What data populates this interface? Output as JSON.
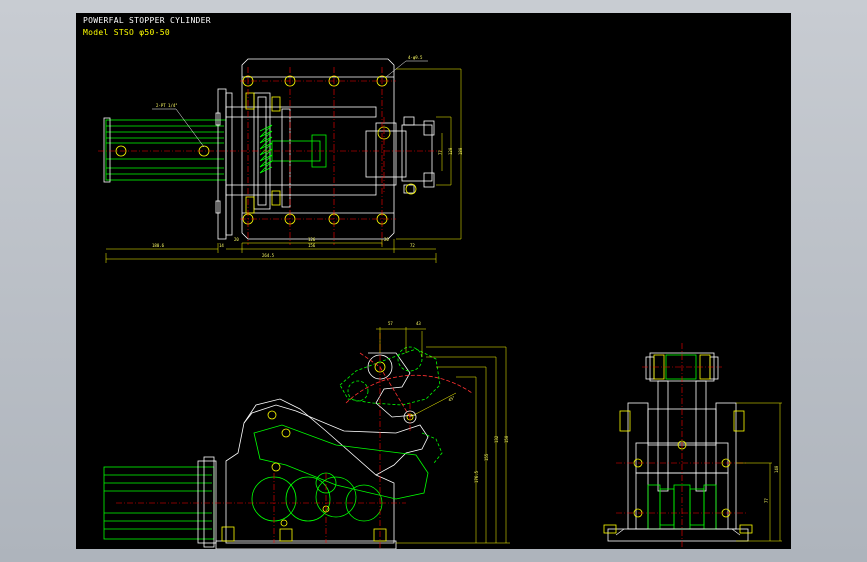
{
  "drawing": {
    "title": "POWERFAL STOPPER CYLINDER",
    "model": "Model STSO φ50-50",
    "colors": {
      "background": "#000000",
      "outline": "#ffffff",
      "centerline": "#ff0000",
      "hidden": "#00ff00",
      "dimension": "#ffff00",
      "arc": "#ff3030"
    }
  },
  "top_view": {
    "callouts": {
      "port": "2-PT 1/4\"",
      "holes": "4-φ9.5"
    },
    "dims": {
      "overall": "264.5",
      "cyl_length": "180.6",
      "flange": "14",
      "d1": "20",
      "span_inner": "126",
      "span_outer": "156",
      "d2": "20",
      "d3": "72",
      "v1": "77",
      "v2": "120",
      "v3": "180"
    }
  },
  "side_view": {
    "dims": {
      "h1": "176.5",
      "h2": "155",
      "h3": "132",
      "h4": "150",
      "top_a": "57",
      "top_b": "43",
      "angle": "45°"
    }
  },
  "end_view": {
    "dims": {
      "w": "140",
      "h": "77"
    }
  }
}
